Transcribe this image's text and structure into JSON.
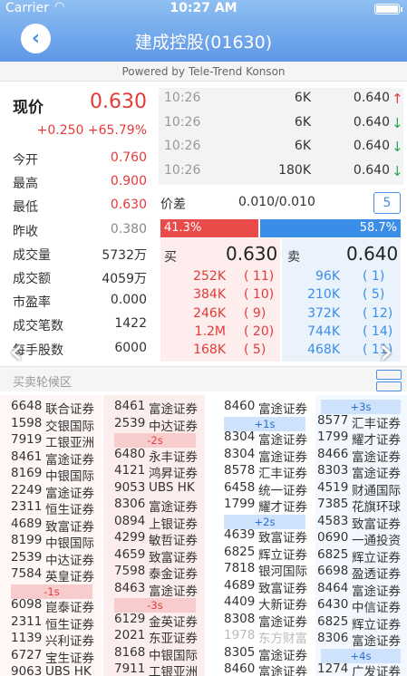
{
  "status": {
    "carrier": "Carrier",
    "time": "10:27 AM"
  },
  "header": {
    "back_icon": "‹",
    "title": "建成控股(01630)"
  },
  "powered": "Powered by Tele-Trend Konson",
  "quote": {
    "now_label": "现价",
    "now_value": "0.630",
    "change": "+0.250 +65.79%",
    "rows": [
      {
        "label": "今开",
        "value": "0.760",
        "color": "red"
      },
      {
        "label": "最高",
        "value": "0.900",
        "color": "red"
      },
      {
        "label": "最低",
        "value": "0.630",
        "color": "red"
      },
      {
        "label": "昨收",
        "value": "0.380",
        "color": "grey"
      },
      {
        "label": "成交量",
        "value": "5732万",
        "color": ""
      },
      {
        "label": "成交额",
        "value": "4059万",
        "color": ""
      },
      {
        "label": "市盈率",
        "value": "0.000",
        "color": ""
      },
      {
        "label": "成交笔数",
        "value": "1422",
        "color": ""
      },
      {
        "label": "每手股数",
        "value": "6000",
        "color": ""
      }
    ]
  },
  "ticker": [
    {
      "time": "10:26",
      "vol": "6K",
      "price": "0.640",
      "dir": "up",
      "arrow": "↑"
    },
    {
      "time": "10:26",
      "vol": "6K",
      "price": "0.640",
      "dir": "down",
      "arrow": "↓"
    },
    {
      "time": "10:26",
      "vol": "6K",
      "price": "0.640",
      "dir": "down",
      "arrow": "↓"
    },
    {
      "time": "10:26",
      "vol": "180K",
      "price": "0.640",
      "dir": "down",
      "arrow": "↓"
    }
  ],
  "spread": {
    "label": "价差",
    "value": "0.010/0.010",
    "box": "5"
  },
  "ratio": {
    "buy_label": "41.3%",
    "buy_pct": 41.3,
    "sell_label": "58.7%",
    "sell_pct": 58.7
  },
  "book": {
    "buy_label": "买",
    "buy_price": "0.630",
    "sell_label": "卖",
    "sell_price": "0.640",
    "buy": [
      {
        "vol": "252K",
        "cnt": "( 11)"
      },
      {
        "vol": "384K",
        "cnt": "( 10)"
      },
      {
        "vol": "246K",
        "cnt": "(  9)"
      },
      {
        "vol": "1.2M",
        "cnt": "( 20)"
      },
      {
        "vol": "168K",
        "cnt": "(  5)"
      }
    ],
    "sell": [
      {
        "vol": "96K",
        "cnt": "(  1)"
      },
      {
        "vol": "210K",
        "cnt": "(  5)"
      },
      {
        "vol": "372K",
        "cnt": "( 12)"
      },
      {
        "vol": "744K",
        "cnt": "( 14)"
      },
      {
        "vol": "468K",
        "cnt": "( 11)"
      }
    ]
  },
  "queue": {
    "label": "买卖轮候区",
    "columns": [
      [
        {
          "code": "6648",
          "name": "联合证券"
        },
        {
          "code": "1598",
          "name": "交银国际"
        },
        {
          "code": "7919",
          "name": "工银亚洲"
        },
        {
          "code": "8461",
          "name": "富途证券"
        },
        {
          "code": "8169",
          "name": "中银国际"
        },
        {
          "code": "2249",
          "name": "富途证券"
        },
        {
          "code": "2311",
          "name": "恒生证券"
        },
        {
          "code": "4689",
          "name": "致富证券"
        },
        {
          "code": "8199",
          "name": "中银国际"
        },
        {
          "code": "2539",
          "name": "中达证券"
        },
        {
          "code": "7584",
          "name": "英皇证券"
        },
        {
          "sep": "-1s",
          "type": "red"
        },
        {
          "code": "6098",
          "name": "崑泰证券"
        },
        {
          "code": "2311",
          "name": "恒生证券"
        },
        {
          "code": "1139",
          "name": "兴利证券"
        },
        {
          "code": "6727",
          "name": "宝生证券"
        },
        {
          "code": "9063",
          "name": "UBS HK"
        }
      ],
      [
        {
          "code": "8461",
          "name": "富途证券"
        },
        {
          "code": "2539",
          "name": "中达证券"
        },
        {
          "sep": "-2s",
          "type": "red"
        },
        {
          "code": "6480",
          "name": "永丰证券"
        },
        {
          "code": "4121",
          "name": "鸿昇证券"
        },
        {
          "code": "9053",
          "name": "UBS HK"
        },
        {
          "code": "8306",
          "name": "富途证券"
        },
        {
          "code": "0894",
          "name": "上银证券"
        },
        {
          "code": "4299",
          "name": "敏哲证券"
        },
        {
          "code": "4659",
          "name": "致富证券"
        },
        {
          "code": "7598",
          "name": "泰金证券"
        },
        {
          "code": "8463",
          "name": "富途证券"
        },
        {
          "sep": "-3s",
          "type": "red"
        },
        {
          "code": "6129",
          "name": "金英证券"
        },
        {
          "code": "2021",
          "name": "东亚证券"
        },
        {
          "code": "8168",
          "name": "中银国际"
        },
        {
          "code": "7911",
          "name": "工银亚洲"
        }
      ],
      [
        {
          "code": "8460",
          "name": "富途证券"
        },
        {
          "sep": "+1s",
          "type": "blue"
        },
        {
          "code": "8304",
          "name": "富途证券"
        },
        {
          "code": "8304",
          "name": "富途证券"
        },
        {
          "code": "8578",
          "name": "汇丰证券"
        },
        {
          "code": "6458",
          "name": "统一证券"
        },
        {
          "code": "1799",
          "name": "耀才证券"
        },
        {
          "sep": "+2s",
          "type": "blue"
        },
        {
          "code": "4639",
          "name": "致富证券"
        },
        {
          "code": "6825",
          "name": "辉立证券"
        },
        {
          "code": "7818",
          "name": "银河国际"
        },
        {
          "code": "4689",
          "name": "致富证券"
        },
        {
          "code": "4409",
          "name": "大新证券"
        },
        {
          "code": "8308",
          "name": "富途证券"
        },
        {
          "code": "1978",
          "name": "东方财富",
          "faded": true
        },
        {
          "code": "8305",
          "name": "富途证券"
        },
        {
          "code": "8460",
          "name": "富途证券"
        }
      ],
      [
        {
          "sep": "+3s",
          "type": "blue"
        },
        {
          "code": "8577",
          "name": "汇丰证券"
        },
        {
          "code": "1799",
          "name": "耀才证券"
        },
        {
          "code": "8466",
          "name": "富途证券"
        },
        {
          "code": "8303",
          "name": "富途证券"
        },
        {
          "code": "4519",
          "name": "财通国际"
        },
        {
          "code": "7385",
          "name": "花旗环球"
        },
        {
          "code": "4583",
          "name": "致富证券"
        },
        {
          "code": "0690",
          "name": "一通投资"
        },
        {
          "code": "6825",
          "name": "辉立证券"
        },
        {
          "code": "6698",
          "name": "盈透证券"
        },
        {
          "code": "8464",
          "name": "富途证券"
        },
        {
          "code": "6430",
          "name": "中信证券"
        },
        {
          "code": "6825",
          "name": "辉立证券"
        },
        {
          "code": "8306",
          "name": "富途证券"
        },
        {
          "sep": "+4s",
          "type": "blue"
        },
        {
          "code": "1274",
          "name": "广发证券"
        }
      ]
    ]
  }
}
